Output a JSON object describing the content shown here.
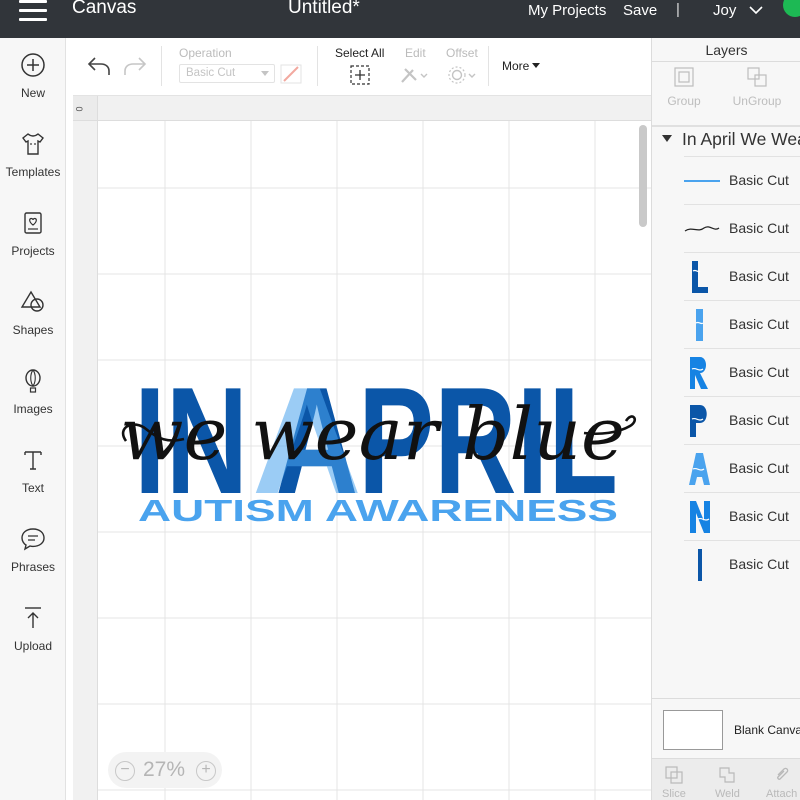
{
  "app": {
    "name": "Canvas",
    "document_title": "Untitled*"
  },
  "topbar": {
    "my_projects": "My Projects",
    "save": "Save",
    "separator": "|",
    "user": "Joy"
  },
  "sidebar": {
    "items": [
      {
        "label": "New",
        "icon": "plus-circle-icon"
      },
      {
        "label": "Templates",
        "icon": "tshirt-icon"
      },
      {
        "label": "Projects",
        "icon": "projects-icon"
      },
      {
        "label": "Shapes",
        "icon": "shapes-icon"
      },
      {
        "label": "Images",
        "icon": "balloon-icon"
      },
      {
        "label": "Text",
        "icon": "text-icon"
      },
      {
        "label": "Phrases",
        "icon": "speech-bubble-icon"
      },
      {
        "label": "Upload",
        "icon": "upload-icon"
      }
    ]
  },
  "toolbar": {
    "operation_label": "Operation",
    "operation_value": "Basic Cut",
    "select_all": "Select All",
    "edit": "Edit",
    "offset": "Offset",
    "more": "More"
  },
  "ruler": {
    "origin": "0"
  },
  "design": {
    "big_text": "IN APRIL",
    "script_text": "we wear blue",
    "sub_text": "AUTISM AWARENESS",
    "colors": {
      "dark_blue": "#0b56a8",
      "mid_blue": "#1683e3",
      "light_blue": "#4aa3ee"
    }
  },
  "zoom": {
    "value": "27%",
    "minus": "−",
    "plus": "+"
  },
  "layers": {
    "title": "Layers",
    "group_button": "Group",
    "ungroup_button": "UnGroup",
    "group_name": "In April We Wear Blue",
    "rows": [
      {
        "label": "Basic Cut",
        "thumb": "autism-awareness"
      },
      {
        "label": "Basic Cut",
        "thumb": "we-wear-blue"
      },
      {
        "label": "Basic Cut",
        "thumb": "L"
      },
      {
        "label": "Basic Cut",
        "thumb": "I"
      },
      {
        "label": "Basic Cut",
        "thumb": "R"
      },
      {
        "label": "Basic Cut",
        "thumb": "P"
      },
      {
        "label": "Basic Cut",
        "thumb": "A"
      },
      {
        "label": "Basic Cut",
        "thumb": "N"
      },
      {
        "label": "Basic Cut",
        "thumb": "I-narrow"
      }
    ],
    "blank_canvas": "Blank Canvas",
    "bottom_tools": [
      "Slice",
      "Weld",
      "Attach"
    ]
  }
}
